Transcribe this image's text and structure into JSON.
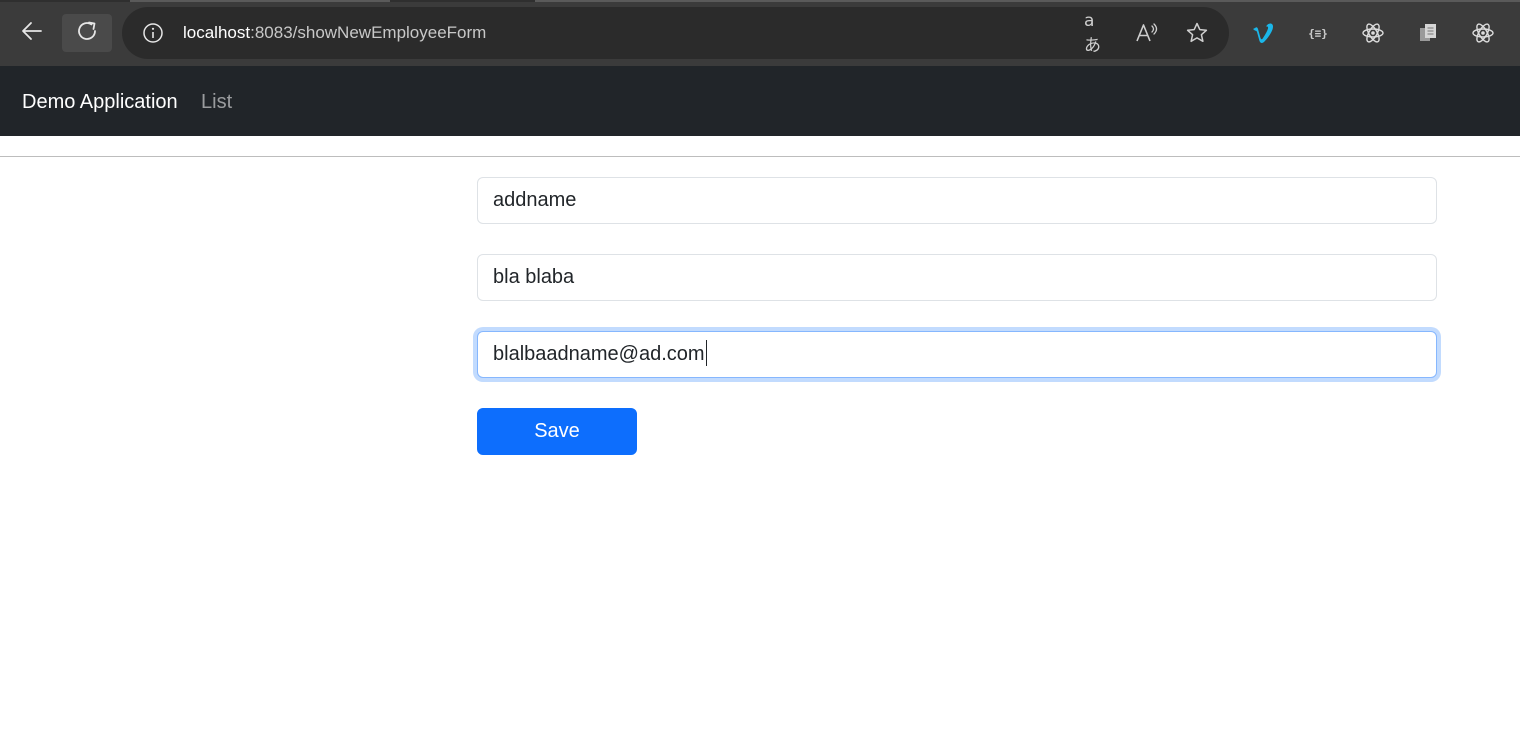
{
  "browser": {
    "url_host": "localhost",
    "url_rest": ":8083/showNewEmployeeForm",
    "icons": {
      "back": "back-arrow-icon",
      "reload": "reload-icon",
      "info": "info-icon",
      "translate": "translate-icon",
      "read_aloud": "read-aloud-icon",
      "favorite": "favorite-star-icon"
    },
    "extensions": [
      "vimeo-extension-icon",
      "json-extension-icon",
      "react-devtools-icon",
      "copy-extension-icon",
      "react-devtools-icon"
    ],
    "json_glyph": "{≡}",
    "translate_glyph": "aあ",
    "read_aloud_glyph": "A",
    "colors": {
      "chrome": "#3b3b3b",
      "omnibox": "#2b2b2b",
      "vimeo": "#1ab7ea"
    }
  },
  "navbar": {
    "brand": "Demo Application",
    "links": [
      {
        "label": "List"
      }
    ],
    "colors": {
      "background": "#212529"
    }
  },
  "form": {
    "fields": [
      {
        "value": "addname"
      },
      {
        "value": "bla blaba"
      },
      {
        "value": "blalbaadname@ad.com",
        "focused": true
      }
    ],
    "save_label": "Save",
    "colors": {
      "primary": "#0d6efd",
      "focus_border": "#86b7fe"
    }
  }
}
